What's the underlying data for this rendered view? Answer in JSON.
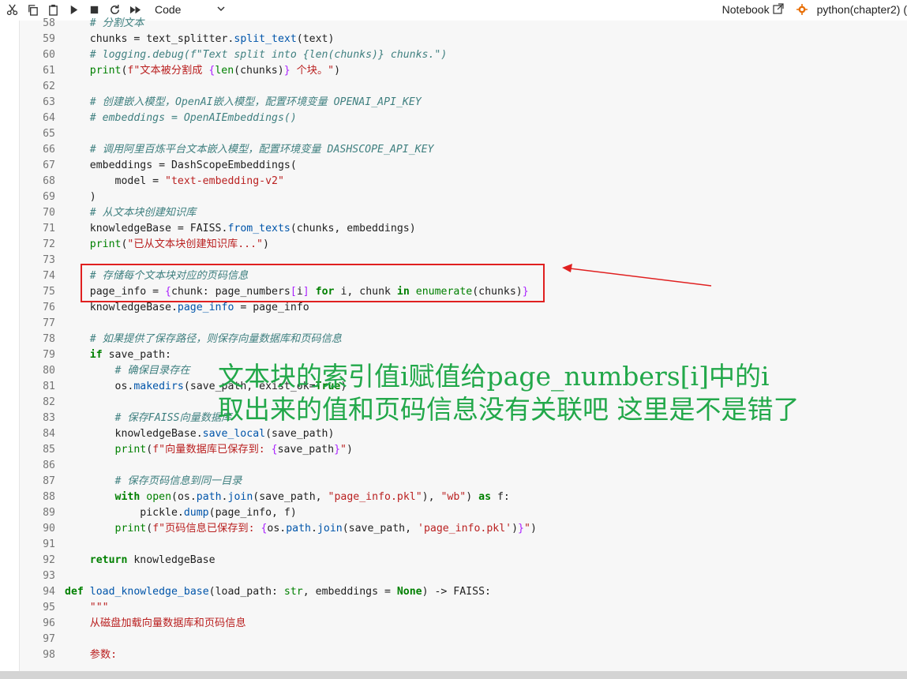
{
  "toolbar": {
    "cell_type": "Code",
    "notebook_label": "Notebook",
    "kernel_label": "python(chapter2) ("
  },
  "code_lines": [
    {
      "n": "58",
      "html": "<span class=\"c\">    # 分割文本</span>"
    },
    {
      "n": "59",
      "html": "    chunks = text_splitter.<span class=\"f\">split_text</span>(text)"
    },
    {
      "n": "60",
      "html": "<span class=\"c\">    # logging.debug(f\"Text split into {len(chunks)} chunks.\")</span>"
    },
    {
      "n": "61",
      "html": "    <span class=\"b\">print</span>(<span class=\"s\">f\"文本被分割成 </span><span class=\"o\">{</span><span class=\"b\">len</span>(chunks)<span class=\"o\">}</span><span class=\"s\"> 个块。\"</span>)"
    },
    {
      "n": "62",
      "html": ""
    },
    {
      "n": "63",
      "html": "<span class=\"c\">    # 创建嵌入模型，OpenAI嵌入模型，配置环境变量 OPENAI_API_KEY</span>"
    },
    {
      "n": "64",
      "html": "<span class=\"c\">    # embeddings = OpenAIEmbeddings()</span>"
    },
    {
      "n": "65",
      "html": ""
    },
    {
      "n": "66",
      "html": "<span class=\"c\">    # 调用阿里百炼平台文本嵌入模型，配置环境变量 DASHSCOPE_API_KEY</span>"
    },
    {
      "n": "67",
      "html": "    embeddings = DashScopeEmbeddings("
    },
    {
      "n": "68",
      "html": "        model = <span class=\"s\">\"text-embedding-v2\"</span>"
    },
    {
      "n": "69",
      "html": "    )"
    },
    {
      "n": "70",
      "html": "<span class=\"c\">    # 从文本块创建知识库</span>"
    },
    {
      "n": "71",
      "html": "    knowledgeBase = FAISS.<span class=\"f\">from_texts</span>(chunks, embeddings)"
    },
    {
      "n": "72",
      "html": "    <span class=\"b\">print</span>(<span class=\"s\">\"已从文本块创建知识库...\"</span>)"
    },
    {
      "n": "73",
      "html": ""
    },
    {
      "n": "74",
      "html": "<span class=\"c\">    # 存储每个文本块对应的页码信息</span>"
    },
    {
      "n": "75",
      "html": "    page_info = <span class=\"o\">{</span>chunk: page_numbers<span class=\"o\">[</span>i<span class=\"o\">]</span> <span class=\"k\">for</span> i, chunk <span class=\"k\">in</span> <span class=\"b\">enumerate</span>(chunks)<span class=\"o\">}</span>"
    },
    {
      "n": "76",
      "html": "    knowledgeBase.<span class=\"f\">page_info</span> = page_info"
    },
    {
      "n": "77",
      "html": ""
    },
    {
      "n": "78",
      "html": "<span class=\"c\">    # 如果提供了保存路径，则保存向量数据库和页码信息</span>"
    },
    {
      "n": "79",
      "html": "    <span class=\"k\">if</span> save_path:"
    },
    {
      "n": "80",
      "html": "<span class=\"c\">        # 确保目录存在</span>"
    },
    {
      "n": "81",
      "html": "        os.<span class=\"f\">makedirs</span>(save_path, exist_ok=<span class=\"k\">True</span>)"
    },
    {
      "n": "82",
      "html": ""
    },
    {
      "n": "83",
      "html": "<span class=\"c\">        # 保存FAISS向量数据库</span>"
    },
    {
      "n": "84",
      "html": "        knowledgeBase.<span class=\"f\">save_local</span>(save_path)"
    },
    {
      "n": "85",
      "html": "        <span class=\"b\">print</span>(<span class=\"s\">f\"向量数据库已保存到: </span><span class=\"o\">{</span>save_path<span class=\"o\">}</span><span class=\"s\">\"</span>)"
    },
    {
      "n": "86",
      "html": ""
    },
    {
      "n": "87",
      "html": "<span class=\"c\">        # 保存页码信息到同一目录</span>"
    },
    {
      "n": "88",
      "html": "        <span class=\"k\">with</span> <span class=\"b\">open</span>(os.<span class=\"f\">path</span>.<span class=\"f\">join</span>(save_path, <span class=\"s\">\"page_info.pkl\"</span>), <span class=\"s\">\"wb\"</span>) <span class=\"k\">as</span> f:"
    },
    {
      "n": "89",
      "html": "            pickle.<span class=\"f\">dump</span>(page_info, f)"
    },
    {
      "n": "90",
      "html": "        <span class=\"b\">print</span>(<span class=\"s\">f\"页码信息已保存到: </span><span class=\"o\">{</span>os.<span class=\"f\">path</span>.<span class=\"f\">join</span>(save_path, <span class=\"s\">'page_info.pkl'</span>)<span class=\"o\">}</span><span class=\"s\">\"</span>)"
    },
    {
      "n": "91",
      "html": ""
    },
    {
      "n": "92",
      "html": "    <span class=\"k\">return</span> knowledgeBase"
    },
    {
      "n": "93",
      "html": ""
    },
    {
      "n": "94",
      "html": "<span class=\"k\">def</span> <span class=\"f\">load_knowledge_base</span>(load_path: <span class=\"b\">str</span>, embeddings = <span class=\"k\">None</span>) -> FAISS:"
    },
    {
      "n": "95",
      "html": "    <span class=\"s\">\"\"\"</span>"
    },
    {
      "n": "96",
      "html": "<span class=\"s\">    从磁盘加载向量数据库和页码信息</span>"
    },
    {
      "n": "97",
      "html": ""
    },
    {
      "n": "98",
      "html": "<span class=\"s\">    参数:</span>"
    }
  ],
  "annotation": {
    "line1": "文本块的索引值i赋值给page_numbers[i]中的i",
    "line2": "取出来的值和页码信息没有关联吧 这里是不是错了"
  },
  "colors": {
    "annotation": "#22a84a",
    "highlight": "#e02020"
  }
}
